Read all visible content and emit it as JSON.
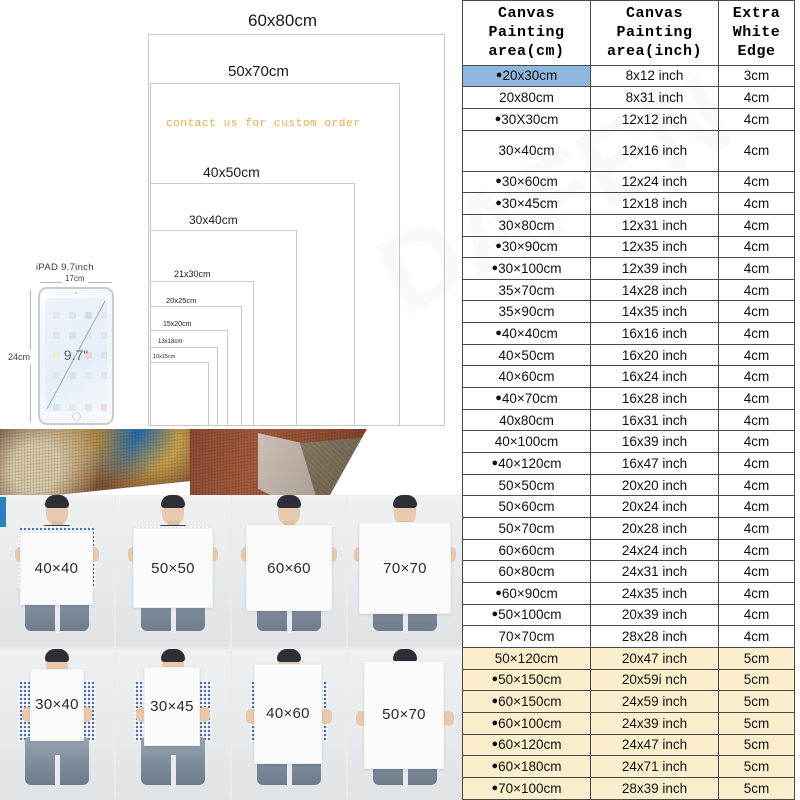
{
  "diagram": {
    "boxes": [
      {
        "label": "60x80cm",
        "label_size": 17
      },
      {
        "label": "50x70cm",
        "label_size": 15
      },
      {
        "label": "40x50cm",
        "label_size": 14
      },
      {
        "label": "30x40cm",
        "label_size": 12
      },
      {
        "label": "21x30cm",
        "label_size": 9
      },
      {
        "label": "20x25cm",
        "label_size": 7.5
      },
      {
        "label": "15x20cm",
        "label_size": 7
      },
      {
        "label": "13x18cm",
        "label_size": 6
      },
      {
        "label": "10x15cm",
        "label_size": 5.5
      }
    ],
    "custom_note": "contact us for  custom  order",
    "custom_note_color": "#F0A84B",
    "ipad": {
      "title": "iPAD 9.7inch",
      "width_label": "17cm",
      "height_label": "24cm",
      "diagonal_label": "9.7\""
    }
  },
  "photo_grid": {
    "cells": [
      {
        "size": "40×40"
      },
      {
        "size": "50×50"
      },
      {
        "size": "60×60"
      },
      {
        "size": "70×70"
      },
      {
        "size": "30×40"
      },
      {
        "size": "30×45"
      },
      {
        "size": "40×60"
      },
      {
        "size": "50×70"
      }
    ]
  },
  "table": {
    "headers": [
      "Canvas Painting area(cm)",
      "Canvas Painting area(inch)",
      "Extra White Edge"
    ],
    "header_lines": [
      [
        "Canvas",
        "Painting",
        "area(cm)"
      ],
      [
        "Canvas",
        "Painting",
        "area(inch)"
      ],
      [
        "Extra",
        "White",
        "Edge"
      ]
    ],
    "highlight_blue": "#8FB8DE",
    "highlight_cream": "#FAEECD",
    "rows": [
      {
        "bullet": true,
        "cm": "20x30cm",
        "inch": "8x12 inch",
        "edge": "3cm",
        "hl": "blue"
      },
      {
        "bullet": false,
        "cm": "20x80cm",
        "inch": "8x31 inch",
        "edge": "4cm",
        "hl": ""
      },
      {
        "bullet": true,
        "cm": "30X30cm",
        "inch": "12x12 inch",
        "edge": "4cm",
        "hl": ""
      },
      {
        "bullet": false,
        "cm": "30×40cm",
        "inch": "12x16 inch",
        "edge": "4cm",
        "hl": "",
        "tall": true
      },
      {
        "bullet": true,
        "cm": "30×60cm",
        "inch": "12x24 inch",
        "edge": "4cm",
        "hl": ""
      },
      {
        "bullet": true,
        "cm": "30×45cm",
        "inch": "12x18 inch",
        "edge": "4cm",
        "hl": ""
      },
      {
        "bullet": false,
        "cm": "30×80cm",
        "inch": "12x31 inch",
        "edge": "4cm",
        "hl": ""
      },
      {
        "bullet": true,
        "cm": "30×90cm",
        "inch": "12x35 inch",
        "edge": "4cm",
        "hl": ""
      },
      {
        "bullet": true,
        "cm": "30×100cm",
        "inch": "12x39 inch",
        "edge": "4cm",
        "hl": ""
      },
      {
        "bullet": false,
        "cm": "35×70cm",
        "inch": "14x28 inch",
        "edge": "4cm",
        "hl": ""
      },
      {
        "bullet": false,
        "cm": "35×90cm",
        "inch": "14x35 inch",
        "edge": "4cm",
        "hl": ""
      },
      {
        "bullet": true,
        "cm": "40×40cm",
        "inch": "16x16 inch",
        "edge": "4cm",
        "hl": ""
      },
      {
        "bullet": false,
        "cm": "40×50cm",
        "inch": "16x20 inch",
        "edge": "4cm",
        "hl": ""
      },
      {
        "bullet": false,
        "cm": "40×60cm",
        "inch": "16x24 inch",
        "edge": "4cm",
        "hl": ""
      },
      {
        "bullet": true,
        "cm": "40×70cm",
        "inch": "16x28 inch",
        "edge": "4cm",
        "hl": ""
      },
      {
        "bullet": false,
        "cm": "40x80cm",
        "inch": "16x31 inch",
        "edge": "4cm",
        "hl": ""
      },
      {
        "bullet": false,
        "cm": "40×100cm",
        "inch": "16x39 inch",
        "edge": "4cm",
        "hl": ""
      },
      {
        "bullet": true,
        "cm": "40×120cm",
        "inch": "16x47 inch",
        "edge": "4cm",
        "hl": ""
      },
      {
        "bullet": false,
        "cm": "50×50cm",
        "inch": "20x20 inch",
        "edge": "4cm",
        "hl": ""
      },
      {
        "bullet": false,
        "cm": "50×60cm",
        "inch": "20x24 inch",
        "edge": "4cm",
        "hl": ""
      },
      {
        "bullet": false,
        "cm": "50×70cm",
        "inch": "20x28 inch",
        "edge": "4cm",
        "hl": ""
      },
      {
        "bullet": false,
        "cm": "60×60cm",
        "inch": "24x24 inch",
        "edge": "4cm",
        "hl": ""
      },
      {
        "bullet": false,
        "cm": "60×80cm",
        "inch": "24x31 inch",
        "edge": "4cm",
        "hl": ""
      },
      {
        "bullet": true,
        "cm": "60×90cm",
        "inch": "24x35 inch",
        "edge": "4cm",
        "hl": ""
      },
      {
        "bullet": true,
        "cm": "50×100cm",
        "inch": "20x39 inch",
        "edge": "4cm",
        "hl": ""
      },
      {
        "bullet": false,
        "cm": "70×70cm",
        "inch": "28x28 inch",
        "edge": "4cm",
        "hl": ""
      },
      {
        "bullet": false,
        "cm": "50×120cm",
        "inch": "20x47 inch",
        "edge": "5cm",
        "hl": "cream"
      },
      {
        "bullet": true,
        "cm": "50×150cm",
        "inch": "20x59i nch",
        "edge": "5cm",
        "hl": "cream"
      },
      {
        "bullet": true,
        "cm": "60×150cm",
        "inch": "24x59 inch",
        "edge": "5cm",
        "hl": "cream"
      },
      {
        "bullet": true,
        "cm": "60×100cm",
        "inch": "24x39 inch",
        "edge": "5cm",
        "hl": "cream"
      },
      {
        "bullet": true,
        "cm": "60×120cm",
        "inch": "24x47 inch",
        "edge": "5cm",
        "hl": "cream"
      },
      {
        "bullet": true,
        "cm": "60×180cm",
        "inch": "24x71 inch",
        "edge": "5cm",
        "hl": "cream"
      },
      {
        "bullet": true,
        "cm": "70×100cm",
        "inch": "28x39 inch",
        "edge": "5cm",
        "hl": "cream"
      }
    ]
  }
}
